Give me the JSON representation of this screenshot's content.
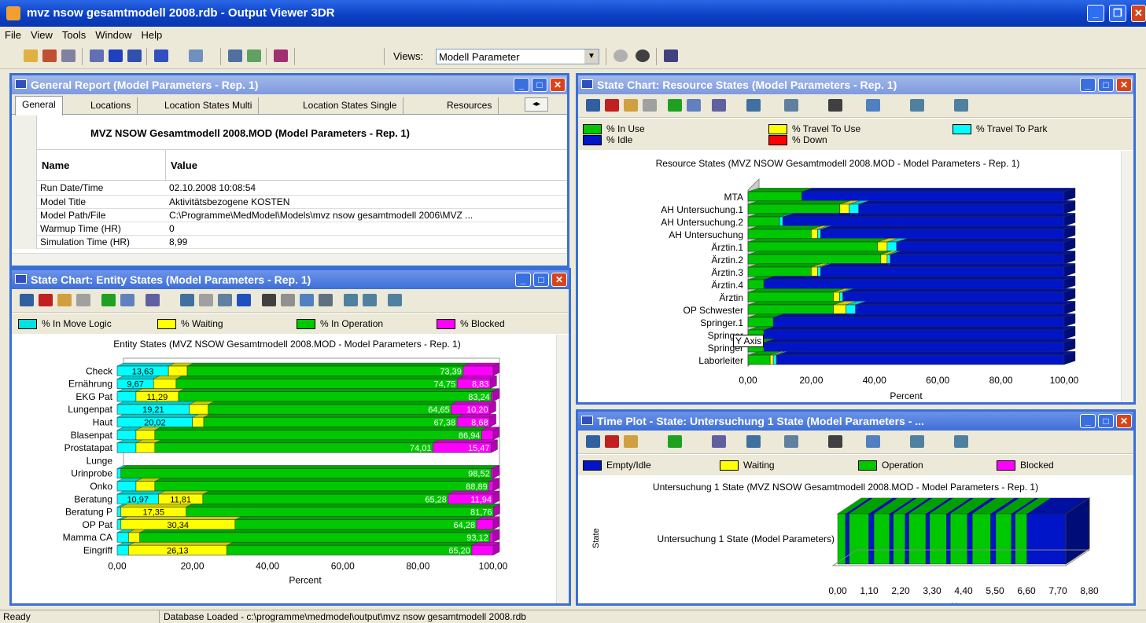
{
  "app": {
    "title": "mvz nsow gesamtmodell  2008.rdb - Output Viewer 3DR"
  },
  "menu": [
    "File",
    "View",
    "Tools",
    "Window",
    "Help"
  ],
  "toolbar": {
    "views_label": "Views:",
    "views_value": "Modell Parameter"
  },
  "colors": {
    "in_use": "#00c800",
    "idle": "#0014c8",
    "travel": "#ffff00",
    "park": "#00ffff",
    "down": "#ff0000",
    "blocked": "#ff00ff",
    "titlebar": "#0a3fc4"
  },
  "general": {
    "title": "General Report (Model Parameters - Rep. 1)",
    "tabs": [
      "General",
      "Locations",
      "Location States Multi",
      "Location States Single",
      "Resources"
    ],
    "heading": "MVZ NSOW Gesamtmodell  2008.MOD (Model Parameters - Rep. 1)",
    "col_name": "Name",
    "col_value": "Value",
    "rows": [
      {
        "name": "Run Date/Time",
        "value": "02.10.2008 10:08:54"
      },
      {
        "name": "Model Title",
        "value": "Aktivitätsbezogene KOSTEN"
      },
      {
        "name": "Model Path/File",
        "value": "C:\\Programme\\MedModel\\Models\\mvz nsow gesamtmodell  2006\\MVZ ..."
      },
      {
        "name": "Warmup Time (HR)",
        "value": "0"
      },
      {
        "name": "Simulation Time (HR)",
        "value": "8,99"
      }
    ]
  },
  "entity": {
    "title": "State Chart: Entity States (Model Parameters - Rep. 1)",
    "legend": [
      "% In Move Logic",
      "% Waiting",
      "% In Operation",
      "% Blocked"
    ]
  },
  "resource": {
    "title": "State Chart: Resource States (Model Parameters - Rep. 1)",
    "legend": [
      "% In Use",
      "% Idle",
      "% Travel To Use",
      "% Down",
      "% Travel To Park"
    ],
    "tooltip": "Y Axis"
  },
  "timeplot": {
    "title": "Time Plot - State: Untersuchung 1 State (Model Parameters - ...",
    "legend": [
      "Empty/Idle",
      "Waiting",
      "Operation",
      "Blocked"
    ]
  },
  "status": {
    "ready": "Ready",
    "db": "Database Loaded - c:\\programme\\medmodel\\output\\mvz nsow gesamtmodell  2008.rdb"
  },
  "chart_data": [
    {
      "type": "bar",
      "title": "Entity States (MVZ NSOW Gesamtmodell  2008.MOD - Model Parameters - Rep. 1)",
      "xlabel": "Percent",
      "ylabel": "",
      "xlim": [
        0,
        100
      ],
      "xticks": [
        "0,00",
        "20,00",
        "40,00",
        "60,00",
        "80,00",
        "100,00"
      ],
      "categories": [
        "Check",
        "Ernährung",
        "EKG Pat",
        "Lungenpat",
        "Haut",
        "Blasenpat",
        "Prostatapat",
        "Lunge",
        "Urinprobe",
        "Onko",
        "Beratung",
        "Beratung P",
        "OP Pat",
        "Mamma CA",
        "Eingriff"
      ],
      "series": [
        {
          "name": "% In Move Logic",
          "values": [
            13.63,
            9.67,
            5,
            19.21,
            20.02,
            5,
            5,
            0,
            1,
            5,
            10.97,
            1,
            1,
            3,
            3
          ],
          "labels": [
            "13,63",
            "9,67",
            "",
            "19,21",
            "20,02",
            "",
            "",
            "",
            "",
            "",
            "10,97",
            "",
            "",
            "",
            ""
          ]
        },
        {
          "name": "% Waiting",
          "values": [
            5,
            6,
            11.29,
            5,
            3,
            5,
            5,
            0,
            0,
            5,
            11.81,
            17.35,
            30.34,
            3,
            26.13
          ],
          "labels": [
            "",
            "",
            "11,29",
            "",
            "",
            "",
            "",
            "",
            "",
            "",
            "11,81",
            "17,35",
            "30,34",
            "",
            "26,13"
          ]
        },
        {
          "name": "% In Operation",
          "values": [
            73.39,
            74.75,
            83.24,
            64.65,
            67.38,
            86.94,
            74.01,
            0,
            98.52,
            88.89,
            65.28,
            81.76,
            64.28,
            93.12,
            65.2
          ],
          "labels": [
            "73,39",
            "74,75",
            "83,24",
            "64,65",
            "67,38",
            "86,94",
            "74,01",
            "",
            "98,52",
            "88,89",
            "65,28",
            "81,76",
            "64,28",
            "93,12",
            "65,20"
          ]
        },
        {
          "name": "% Blocked",
          "values": [
            7.98,
            8.83,
            0.47,
            10.2,
            8.68,
            3.06,
            15.47,
            0,
            0.48,
            1.11,
            11.94,
            0,
            4.38,
            0.88,
            5.67
          ],
          "labels": [
            "",
            "8,83",
            "",
            "10,20",
            "8,68",
            "",
            "15,47",
            "",
            "",
            "",
            "11,94",
            "",
            "",
            "",
            ""
          ]
        }
      ]
    },
    {
      "type": "bar",
      "title": "Resource States (MVZ NSOW Gesamtmodell  2008.MOD - Model Parameters - Rep. 1)",
      "xlabel": "Percent",
      "ylabel": "",
      "xlim": [
        0,
        100
      ],
      "xticks": [
        "0,00",
        "20,00",
        "40,00",
        "60,00",
        "80,00",
        "100,00"
      ],
      "categories": [
        "MTA",
        "AH Untersuchung.1",
        "AH Untersuchung.2",
        "AH Untersuchung",
        "Ärztin.1",
        "Ärztin.2",
        "Ärztin.3",
        "Ärztin.4",
        "Ärztin",
        "OP Schwester",
        "Springer.1",
        "Springer",
        "Springer",
        "Laborleiter"
      ],
      "series": [
        {
          "name": "% In Use",
          "values": [
            17,
            29,
            10,
            20,
            41,
            42,
            20,
            5,
            27,
            27,
            8,
            5,
            5,
            7
          ]
        },
        {
          "name": "% Travel To Use",
          "values": [
            0,
            3,
            0,
            2,
            3,
            2,
            2,
            0,
            2,
            4,
            0,
            0,
            0,
            1
          ]
        },
        {
          "name": "% Travel To Park",
          "values": [
            0,
            3,
            1,
            1,
            3,
            1,
            1,
            0,
            1,
            3,
            0,
            0,
            0,
            1
          ]
        },
        {
          "name": "% Down",
          "values": [
            0,
            0,
            0,
            0,
            0,
            0,
            0,
            0,
            0,
            0,
            0,
            0,
            0,
            0
          ]
        },
        {
          "name": "% Idle",
          "values": [
            83,
            65,
            89,
            77,
            53,
            55,
            77,
            95,
            70,
            66,
            92,
            95,
            95,
            91
          ]
        }
      ]
    },
    {
      "type": "bar",
      "title": "Untersuchung 1 State (MVZ NSOW Gesamtmodell  2008.MOD - Model Parameters - Rep. 1)",
      "xlabel": "Hours",
      "ylabel": "State",
      "xlim": [
        0,
        8.8
      ],
      "xticks": [
        "0,00",
        "1,10",
        "2,20",
        "3,30",
        "4,40",
        "5,50",
        "6,60",
        "7,70",
        "8,80"
      ],
      "categories": [
        "Untersuchung 1 State (Model Parameters)"
      ],
      "segments": [
        [
          0,
          0.3,
          "Operation"
        ],
        [
          0.3,
          0.45,
          "Empty/Idle"
        ],
        [
          0.45,
          1.2,
          "Operation"
        ],
        [
          1.2,
          1.4,
          "Empty/Idle"
        ],
        [
          1.4,
          2.0,
          "Operation"
        ],
        [
          2.0,
          2.15,
          "Empty/Idle"
        ],
        [
          2.15,
          2.6,
          "Operation"
        ],
        [
          2.6,
          2.75,
          "Empty/Idle"
        ],
        [
          2.75,
          3.4,
          "Operation"
        ],
        [
          3.4,
          3.55,
          "Empty/Idle"
        ],
        [
          3.55,
          4.2,
          "Operation"
        ],
        [
          4.2,
          4.35,
          "Empty/Idle"
        ],
        [
          4.35,
          5.0,
          "Operation"
        ],
        [
          5.0,
          5.2,
          "Empty/Idle"
        ],
        [
          5.2,
          5.9,
          "Operation"
        ],
        [
          5.9,
          6.1,
          "Empty/Idle"
        ],
        [
          6.1,
          6.7,
          "Operation"
        ],
        [
          6.7,
          6.85,
          "Empty/Idle"
        ],
        [
          6.85,
          7.3,
          "Operation"
        ],
        [
          7.3,
          8.8,
          "Empty/Idle"
        ]
      ]
    }
  ]
}
